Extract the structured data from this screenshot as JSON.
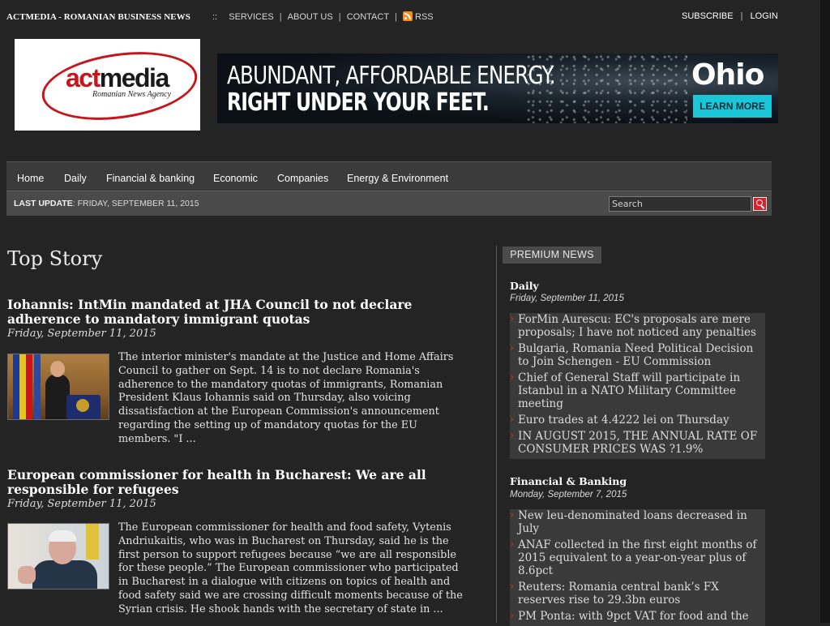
{
  "topbar": {
    "site_title": "ACTMEDIA - ROMANIAN BUSINESS NEWS",
    "prefix": "::",
    "links": [
      "SERVICES",
      "ABOUT US",
      "CONTACT"
    ],
    "rss_label": "RSS",
    "subscribe": "SUBSCRIBE",
    "login": "LOGIN"
  },
  "logo": {
    "act": "act",
    "media": "media",
    "tagline": "Romanian News Agency"
  },
  "banner": {
    "line1": "ABUNDANT, AFFORDABLE ENERGY.",
    "line2": "RIGHT UNDER YOUR FEET.",
    "brand": "Ohio",
    "cta": "LEARN MORE"
  },
  "nav": {
    "items": [
      "Home",
      "Daily",
      "Financial & banking",
      "Economic",
      "Companies",
      "Energy & Environment"
    ],
    "last_update_label": "LAST UPDATE",
    "last_update_value": ": FRIDAY, SEPTEMBER 11, 2015",
    "search_placeholder": "Search"
  },
  "main": {
    "section_title": "Top Story",
    "articles": [
      {
        "title": "Iohannis: IntMin mandated at JHA Council to not declare adherence to mandatory immigrant quotas",
        "date": "Friday, September 11, 2015",
        "body": "The interior minister's mandate at the Justice and Home Affairs Council to gather on Sept. 14 is to not declare Romania's adherence to the mandatory quotas of immigrants, Romanian President Klaus Iohannis said on Thursday, also voicing dissatisfaction at the European Commission's announcement regarding the setting up of mandatory quotas for the EU members. \"I ..."
      },
      {
        "title": "European commissioner for health in Bucharest: We are all responsible for refugees",
        "date": "Friday, September 11, 2015",
        "body": "The European commissioner for health and food safety, Vytenis Andriukaitis, who was in Bucharest on Thursday, said he is the first person to support refugees because “we are all responsible for these people.” The European commissioner who participated in Bucharest in a dialogue with citizens on topics of health and food safety said we are crossing difficult moments because of the Syrian crisis. He shook hands with the secretary of state in ..."
      }
    ]
  },
  "sidebar": {
    "tab_label": "PREMIUM NEWS",
    "sections": [
      {
        "title": "Daily",
        "date": "Friday, September 11, 2015",
        "items": [
          "ForMin Aurescu: EC's proposals are mere proposals; I have not noticed any penalties",
          "Bulgaria, Romania Need Political Decision to Join Schengen - EU Commission",
          "Chief of General Staff will participate in Istanbul in a NATO Military Committee meeting",
          "Euro trades at 4.4222 lei on Thursday",
          "IN AUGUST 2015, THE ANNUAL RATE OF CONSUMER PRICES WAS ?1.9%"
        ]
      },
      {
        "title": "Financial & Banking",
        "date": "Monday, September 7, 2015",
        "items": [
          "New leu-denominated loans decreased in July",
          "ANAF collected in the first eight months of 2015 equivalent to a year-on-year plus of 8.6pct",
          "Reuters: Romania central bank’s FX reserves rise to 29.3bn euros",
          "PM Ponta: with 9pct VAT for food and the"
        ]
      }
    ]
  },
  "colors": {
    "background": "#242424",
    "nav": "#3b3b3b",
    "accent_red": "#d6232a",
    "logo_red": "#c6161b",
    "cta_cyan": "#1bc6d9"
  }
}
